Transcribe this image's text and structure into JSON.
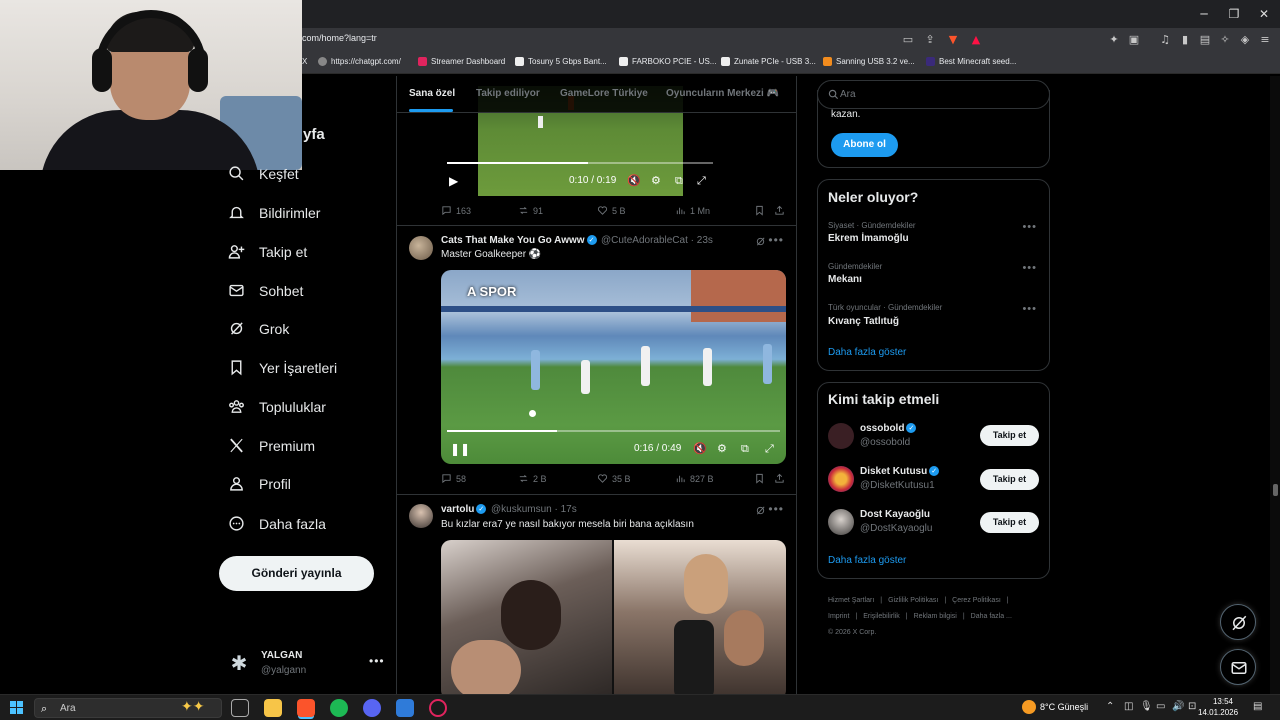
{
  "browser": {
    "url": "com/home?lang=tr",
    "bookmarks": [
      {
        "label": "X"
      },
      {
        "label": "https://chatgpt.com/"
      },
      {
        "label": "Streamer Dashboard"
      },
      {
        "label": "Tosuny 5 Gbps Bant..."
      },
      {
        "label": "FARBOKO PCIE - US..."
      },
      {
        "label": "Zunate PCIe - USB 3..."
      },
      {
        "label": "Sanning USB 3.2 ve..."
      },
      {
        "label": "Best Minecraft seed..."
      }
    ]
  },
  "nav": {
    "home_partial": "yfa",
    "items": [
      {
        "label": "Keşfet",
        "icon": "search-icon"
      },
      {
        "label": "Bildirimler",
        "icon": "bell-icon"
      },
      {
        "label": "Takip et",
        "icon": "person-add-icon"
      },
      {
        "label": "Sohbet",
        "icon": "mail-icon"
      },
      {
        "label": "Grok",
        "icon": "grok-icon"
      },
      {
        "label": "Yer İşaretleri",
        "icon": "bookmark-icon"
      },
      {
        "label": "Topluluklar",
        "icon": "communities-icon"
      },
      {
        "label": "Premium",
        "icon": "x-logo-icon"
      },
      {
        "label": "Profil",
        "icon": "person-icon"
      },
      {
        "label": "Daha fazla",
        "icon": "more-circle-icon"
      }
    ],
    "post_button": "Gönderi yayınla",
    "account": {
      "name": "YALGAN",
      "handle": "@yalgann"
    }
  },
  "feed": {
    "tabs": [
      {
        "label": "Sana özel",
        "active": true
      },
      {
        "label": "Takip ediliyor",
        "active": false
      },
      {
        "label": "GameLore Türkiye",
        "active": false
      },
      {
        "label": "Oyuncuların Merkezi 🎮",
        "active": false
      }
    ],
    "tweets": [
      {
        "video": {
          "time": "0:10 / 0:19",
          "progress": 0.53
        },
        "stats": {
          "replies": "163",
          "reposts": "91",
          "likes": "5 B",
          "views": "1 Mn"
        }
      },
      {
        "name": "Cats That Make You Go Awww",
        "handle": "@CuteAdorableCat · 23s",
        "text": "Master Goalkeeper ⚽",
        "video": {
          "time": "0:16 / 0:49",
          "progress": 0.33,
          "watermark": "A SPOR"
        },
        "stats": {
          "replies": "58",
          "reposts": "2 B",
          "likes": "35 B",
          "views": "827 B"
        }
      },
      {
        "name": "vartolu",
        "handle": "@kuskumsun · 17s",
        "text": "Bu kızlar era7 ye nasıl bakıyor mesela biri bana açıklasın"
      }
    ]
  },
  "sidebar": {
    "search_placeholder": "Ara",
    "premium": {
      "text": "kazan.",
      "button": "Abone ol"
    },
    "trends": {
      "title": "Neler oluyor?",
      "items": [
        {
          "category": "Siyaset · Gündemdekiler",
          "name": "Ekrem İmamoğlu"
        },
        {
          "category": "Gündemdekiler",
          "name": "Mekanı"
        },
        {
          "category": "Türk oyuncular · Gündemdekiler",
          "name": "Kıvanç Tatlıtuğ"
        }
      ],
      "show_more": "Daha fazla göster"
    },
    "who_to_follow": {
      "title": "Kimi takip etmeli",
      "items": [
        {
          "name": "ossobold",
          "handle": "@ossobold",
          "button": "Takip et"
        },
        {
          "name": "Disket Kutusu",
          "handle": "@DisketKutusu1",
          "button": "Takip et"
        },
        {
          "name": "Dost Kayaoğlu",
          "handle": "@DostKayaoglu",
          "button": "Takip et"
        }
      ],
      "show_more": "Daha fazla göster"
    },
    "footer": [
      "Hizmet Şartları",
      "|",
      "Gizlilik Politikası",
      "|",
      "Çerez Politikası",
      "|",
      "Imprint",
      "|",
      "Erişilebilirlik",
      "|",
      "Reklam bilgisi",
      "|",
      "Daha fazla ...",
      "© 2026 X Corp."
    ]
  },
  "taskbar": {
    "search": "Ara",
    "weather": "8°C  Güneşli",
    "time": "13:54",
    "date": "14.01.2026"
  },
  "colors": {
    "accent": "#1d9bf0",
    "bg": "#000000",
    "border": "#2f3336",
    "muted": "#71767b"
  }
}
